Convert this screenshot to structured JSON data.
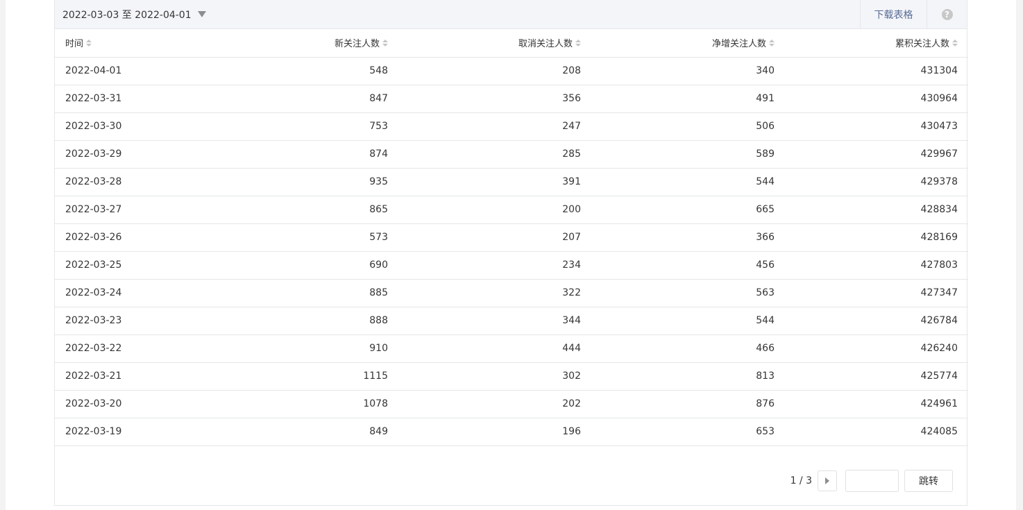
{
  "toolbar": {
    "date_range": "2022-03-03 至 2022-04-01",
    "download_label": "下载表格",
    "help_label": "?"
  },
  "table": {
    "columns": [
      "时间",
      "新关注人数",
      "取消关注人数",
      "净增关注人数",
      "累积关注人数"
    ],
    "rows": [
      [
        "2022-04-01",
        "548",
        "208",
        "340",
        "431304"
      ],
      [
        "2022-03-31",
        "847",
        "356",
        "491",
        "430964"
      ],
      [
        "2022-03-30",
        "753",
        "247",
        "506",
        "430473"
      ],
      [
        "2022-03-29",
        "874",
        "285",
        "589",
        "429967"
      ],
      [
        "2022-03-28",
        "935",
        "391",
        "544",
        "429378"
      ],
      [
        "2022-03-27",
        "865",
        "200",
        "665",
        "428834"
      ],
      [
        "2022-03-26",
        "573",
        "207",
        "366",
        "428169"
      ],
      [
        "2022-03-25",
        "690",
        "234",
        "456",
        "427803"
      ],
      [
        "2022-03-24",
        "885",
        "322",
        "563",
        "427347"
      ],
      [
        "2022-03-23",
        "888",
        "344",
        "544",
        "426784"
      ],
      [
        "2022-03-22",
        "910",
        "444",
        "466",
        "426240"
      ],
      [
        "2022-03-21",
        "1115",
        "302",
        "813",
        "425774"
      ],
      [
        "2022-03-20",
        "1078",
        "202",
        "876",
        "424961"
      ],
      [
        "2022-03-19",
        "849",
        "196",
        "653",
        "424085"
      ]
    ]
  },
  "pager": {
    "page_indicator": "1 / 3",
    "jump_value": "",
    "jump_label": "跳转"
  },
  "colors": {
    "link": "#576b95",
    "border": "#e5e6e8",
    "toolbar_bg": "#f4f5f9",
    "text": "#353535"
  }
}
